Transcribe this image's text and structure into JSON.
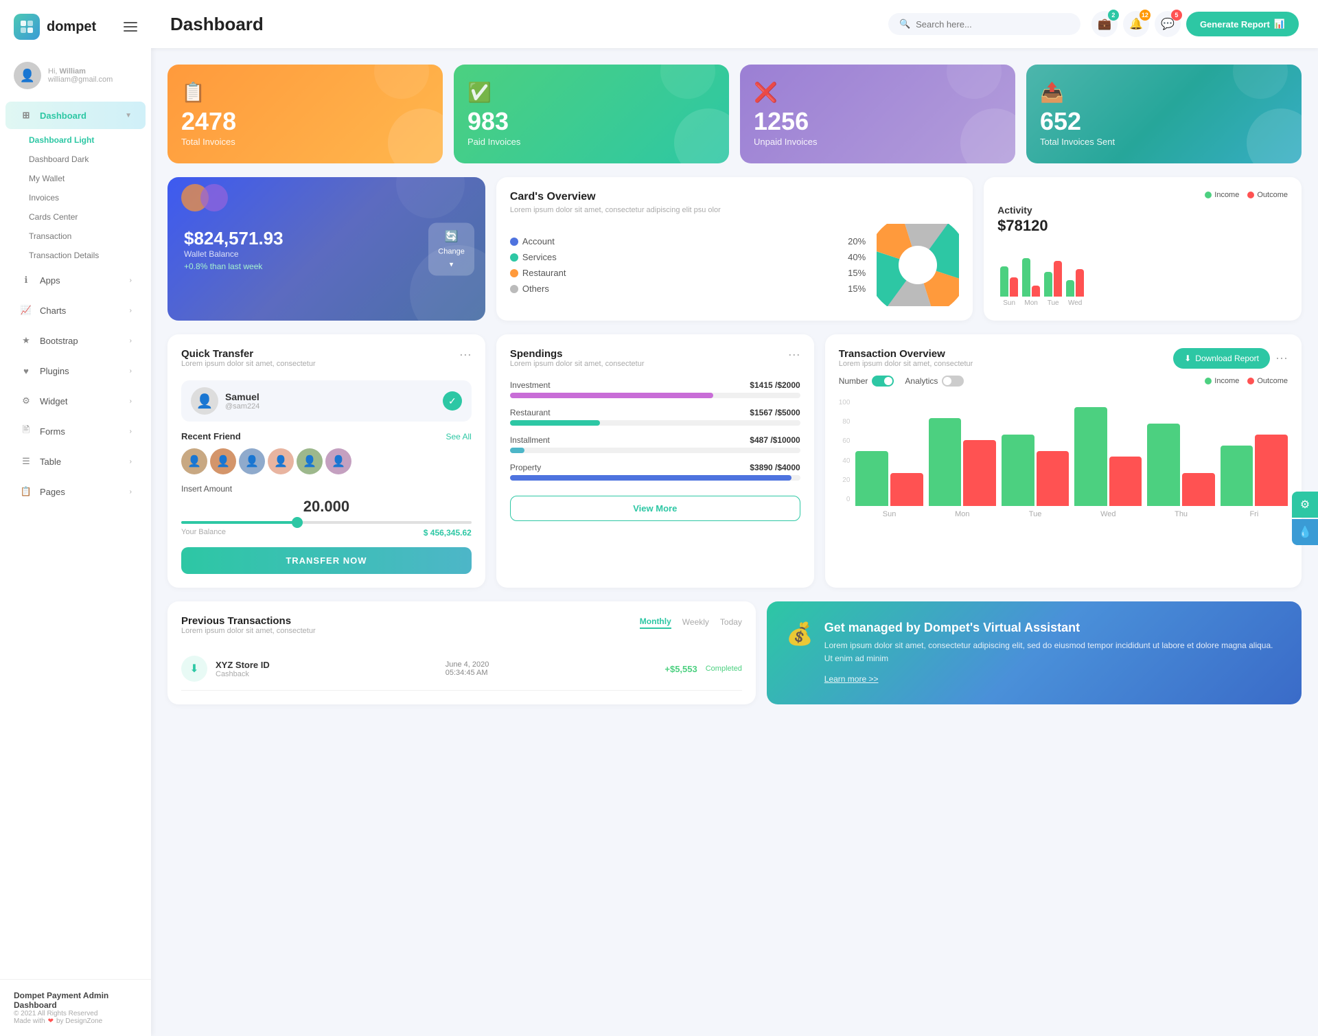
{
  "app": {
    "name": "dompet",
    "title": "Dashboard"
  },
  "topbar": {
    "search_placeholder": "Search here...",
    "generate_btn": "Generate Report",
    "badges": {
      "wallet": "2",
      "bell": "12",
      "chat": "5"
    }
  },
  "user": {
    "hi": "Hi,",
    "name": "William",
    "email": "william@gmail.com"
  },
  "sidebar": {
    "nav_items": [
      {
        "label": "Dashboard",
        "icon": "⊞",
        "active": true,
        "has_arrow": true
      },
      {
        "label": "Apps",
        "icon": "ℹ",
        "has_arrow": true
      },
      {
        "label": "Charts",
        "icon": "📈",
        "has_arrow": true
      },
      {
        "label": "Bootstrap",
        "icon": "★",
        "has_arrow": true
      },
      {
        "label": "Plugins",
        "icon": "♥",
        "has_arrow": true
      },
      {
        "label": "Widget",
        "icon": "⚙",
        "has_arrow": true
      },
      {
        "label": "Forms",
        "icon": "🖹",
        "has_arrow": true
      },
      {
        "label": "Table",
        "icon": "☰",
        "has_arrow": true
      },
      {
        "label": "Pages",
        "icon": "📋",
        "has_arrow": true
      }
    ],
    "sub_items": [
      "Dashboard Light",
      "Dashboard Dark",
      "My Wallet",
      "Invoices",
      "Cards Center",
      "Transaction",
      "Transaction Details"
    ],
    "footer": {
      "title": "Dompet Payment Admin Dashboard",
      "copy": "© 2021 All Rights Reserved",
      "made": "Made with ❤ by DesignZone"
    }
  },
  "stat_cards": [
    {
      "icon": "📋",
      "number": "2478",
      "label": "Total Invoices",
      "color": "orange"
    },
    {
      "icon": "✓",
      "number": "983",
      "label": "Paid Invoices",
      "color": "green"
    },
    {
      "icon": "✕",
      "number": "1256",
      "label": "Unpaid Invoices",
      "color": "purple"
    },
    {
      "icon": "📤",
      "number": "652",
      "label": "Total Invoices Sent",
      "color": "teal"
    }
  ],
  "wallet": {
    "amount": "$824,571.93",
    "label": "Wallet Balance",
    "change": "+0.8% than last week",
    "change_btn": "Change"
  },
  "cards_overview": {
    "title": "Card's Overview",
    "desc": "Lorem ipsum dolor sit amet, consectetur adipiscing elit psu olor",
    "items": [
      {
        "label": "Account",
        "pct": "20%",
        "color": "blue"
      },
      {
        "label": "Services",
        "pct": "40%",
        "color": "green"
      },
      {
        "label": "Restaurant",
        "pct": "15%",
        "color": "orange"
      },
      {
        "label": "Others",
        "pct": "15%",
        "color": "gray"
      }
    ]
  },
  "activity": {
    "title": "Activity",
    "amount": "$78120",
    "legend": {
      "income": "Income",
      "outcome": "Outcome"
    },
    "bars": [
      {
        "day": "Sun",
        "income": 55,
        "outcome": 35
      },
      {
        "day": "Mon",
        "income": 70,
        "outcome": 20
      },
      {
        "day": "Tue",
        "income": 45,
        "outcome": 65
      },
      {
        "day": "Wed",
        "income": 30,
        "outcome": 50
      }
    ]
  },
  "quick_transfer": {
    "title": "Quick Transfer",
    "desc": "Lorem ipsum dolor sit amet, consectetur",
    "user": {
      "name": "Samuel",
      "handle": "@sam224"
    },
    "recent_friend_label": "Recent Friend",
    "see_all": "See All",
    "insert_amount_label": "Insert Amount",
    "amount": "20.000",
    "balance_label": "Your Balance",
    "balance_value": "$ 456,345.62",
    "transfer_btn": "TRANSFER NOW"
  },
  "spendings": {
    "title": "Spendings",
    "desc": "Lorem ipsum dolor sit amet, consectetur",
    "items": [
      {
        "name": "Investment",
        "current": "$1415",
        "max": "$2000",
        "pct": 70,
        "color": "#c86dd7"
      },
      {
        "name": "Restaurant",
        "current": "$1567",
        "max": "$5000",
        "pct": 31,
        "color": "#2dc7a4"
      },
      {
        "name": "Installment",
        "current": "$487",
        "max": "$10000",
        "pct": 5,
        "color": "#4db6c8"
      },
      {
        "name": "Property",
        "current": "$3890",
        "max": "$4000",
        "pct": 97,
        "color": "#4e73df"
      }
    ],
    "view_more_btn": "View More"
  },
  "transaction_overview": {
    "title": "Transaction Overview",
    "desc": "Lorem ipsum dolor sit amet, consectetur",
    "download_btn": "Download Report",
    "toggles": {
      "number": "Number",
      "analytics": "Analytics"
    },
    "legend": {
      "income": "Income",
      "outcome": "Outcome"
    },
    "bars": [
      {
        "day": "Sun",
        "income": 50,
        "outcome": 30
      },
      {
        "day": "Mon",
        "income": 80,
        "outcome": 60
      },
      {
        "day": "Tue",
        "income": 65,
        "outcome": 50
      },
      {
        "day": "Wed",
        "income": 90,
        "outcome": 45
      },
      {
        "day": "Thu",
        "income": 75,
        "outcome": 30
      },
      {
        "day": "Fri",
        "income": 55,
        "outcome": 65
      }
    ],
    "y_labels": [
      "100",
      "80",
      "60",
      "40",
      "20",
      "0"
    ]
  },
  "previous_transactions": {
    "title": "Previous Transactions",
    "desc": "Lorem ipsum dolor sit amet, consectetur",
    "tabs": [
      "Monthly",
      "Weekly",
      "Today"
    ],
    "active_tab": "Monthly",
    "items": [
      {
        "name": "XYZ Store ID",
        "type": "Cashback",
        "date": "June 4, 2020",
        "time": "05:34:45 AM",
        "amount": "+$5,553",
        "status": "Completed"
      }
    ]
  },
  "virtual_assistant": {
    "title": "Get managed by Dompet's Virtual Assistant",
    "desc": "Lorem ipsum dolor sit amet, consectetur adipiscing elit, sed do eiusmod tempor incididunt ut labore et dolore magna aliqua. Ut enim ad minim",
    "link": "Learn more >>"
  }
}
